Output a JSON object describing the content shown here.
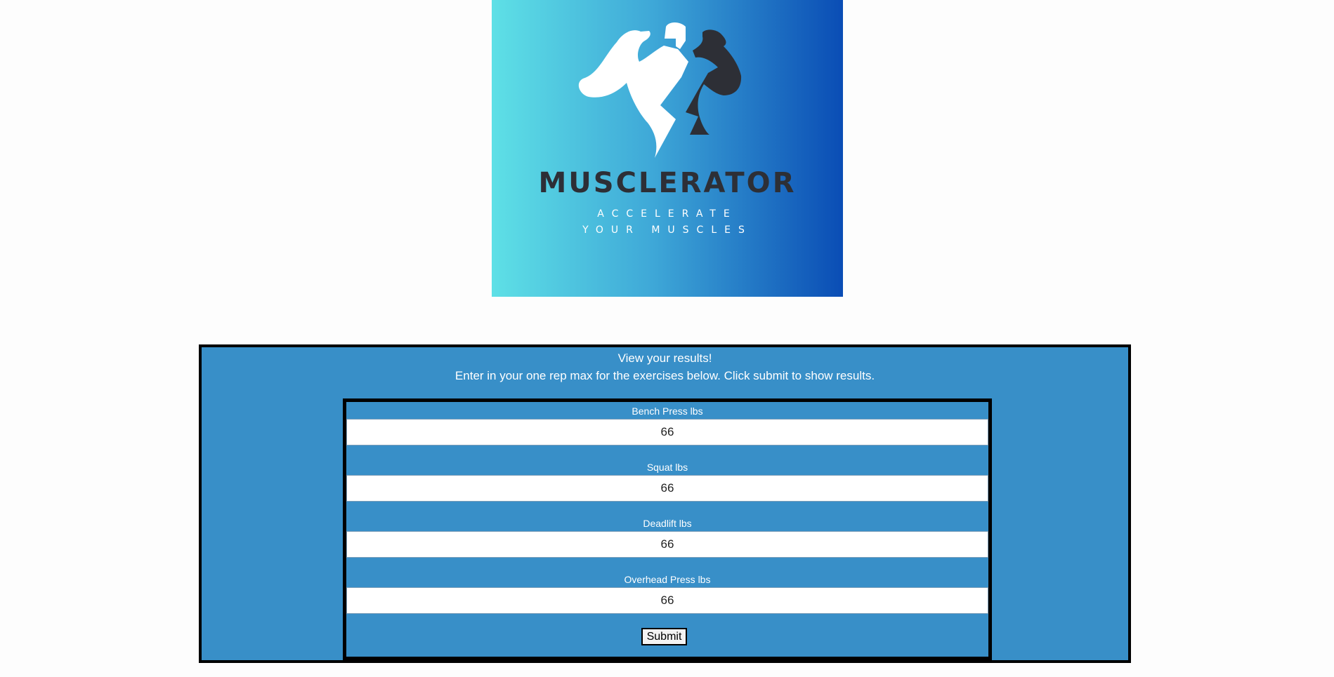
{
  "logo": {
    "brand": "MUSCLERATOR",
    "tagline": "ACCELERATE YOUR MUSCLES",
    "gradient_start": "#5ee0e6",
    "gradient_end": "#0a4db5",
    "icon": "flexing-man-lightning-icon"
  },
  "panel": {
    "title": "View your results!",
    "subtitle": "Enter in your one rep max for the exercises below. Click submit to show results.",
    "background": "#388fc8"
  },
  "form": {
    "fields": [
      {
        "label": "Bench Press lbs",
        "value": "66"
      },
      {
        "label": "Squat lbs",
        "value": "66"
      },
      {
        "label": "Deadlift lbs",
        "value": "66"
      },
      {
        "label": "Overhead Press lbs",
        "value": "66"
      }
    ],
    "submit_label": "Submit"
  }
}
